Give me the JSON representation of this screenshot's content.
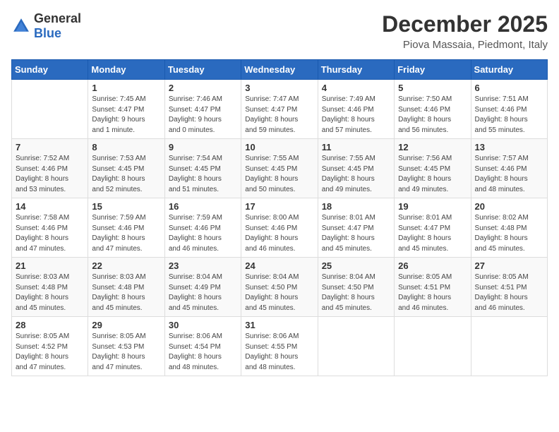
{
  "logo": {
    "general": "General",
    "blue": "Blue"
  },
  "header": {
    "month": "December 2025",
    "location": "Piova Massaia, Piedmont, Italy"
  },
  "days": [
    "Sunday",
    "Monday",
    "Tuesday",
    "Wednesday",
    "Thursday",
    "Friday",
    "Saturday"
  ],
  "weeks": [
    [
      {
        "day": "",
        "info": ""
      },
      {
        "day": "1",
        "info": "Sunrise: 7:45 AM\nSunset: 4:47 PM\nDaylight: 9 hours\nand 1 minute."
      },
      {
        "day": "2",
        "info": "Sunrise: 7:46 AM\nSunset: 4:47 PM\nDaylight: 9 hours\nand 0 minutes."
      },
      {
        "day": "3",
        "info": "Sunrise: 7:47 AM\nSunset: 4:47 PM\nDaylight: 8 hours\nand 59 minutes."
      },
      {
        "day": "4",
        "info": "Sunrise: 7:49 AM\nSunset: 4:46 PM\nDaylight: 8 hours\nand 57 minutes."
      },
      {
        "day": "5",
        "info": "Sunrise: 7:50 AM\nSunset: 4:46 PM\nDaylight: 8 hours\nand 56 minutes."
      },
      {
        "day": "6",
        "info": "Sunrise: 7:51 AM\nSunset: 4:46 PM\nDaylight: 8 hours\nand 55 minutes."
      }
    ],
    [
      {
        "day": "7",
        "info": "Sunrise: 7:52 AM\nSunset: 4:46 PM\nDaylight: 8 hours\nand 53 minutes."
      },
      {
        "day": "8",
        "info": "Sunrise: 7:53 AM\nSunset: 4:45 PM\nDaylight: 8 hours\nand 52 minutes."
      },
      {
        "day": "9",
        "info": "Sunrise: 7:54 AM\nSunset: 4:45 PM\nDaylight: 8 hours\nand 51 minutes."
      },
      {
        "day": "10",
        "info": "Sunrise: 7:55 AM\nSunset: 4:45 PM\nDaylight: 8 hours\nand 50 minutes."
      },
      {
        "day": "11",
        "info": "Sunrise: 7:55 AM\nSunset: 4:45 PM\nDaylight: 8 hours\nand 49 minutes."
      },
      {
        "day": "12",
        "info": "Sunrise: 7:56 AM\nSunset: 4:45 PM\nDaylight: 8 hours\nand 49 minutes."
      },
      {
        "day": "13",
        "info": "Sunrise: 7:57 AM\nSunset: 4:46 PM\nDaylight: 8 hours\nand 48 minutes."
      }
    ],
    [
      {
        "day": "14",
        "info": "Sunrise: 7:58 AM\nSunset: 4:46 PM\nDaylight: 8 hours\nand 47 minutes."
      },
      {
        "day": "15",
        "info": "Sunrise: 7:59 AM\nSunset: 4:46 PM\nDaylight: 8 hours\nand 47 minutes."
      },
      {
        "day": "16",
        "info": "Sunrise: 7:59 AM\nSunset: 4:46 PM\nDaylight: 8 hours\nand 46 minutes."
      },
      {
        "day": "17",
        "info": "Sunrise: 8:00 AM\nSunset: 4:46 PM\nDaylight: 8 hours\nand 46 minutes."
      },
      {
        "day": "18",
        "info": "Sunrise: 8:01 AM\nSunset: 4:47 PM\nDaylight: 8 hours\nand 45 minutes."
      },
      {
        "day": "19",
        "info": "Sunrise: 8:01 AM\nSunset: 4:47 PM\nDaylight: 8 hours\nand 45 minutes."
      },
      {
        "day": "20",
        "info": "Sunrise: 8:02 AM\nSunset: 4:48 PM\nDaylight: 8 hours\nand 45 minutes."
      }
    ],
    [
      {
        "day": "21",
        "info": "Sunrise: 8:03 AM\nSunset: 4:48 PM\nDaylight: 8 hours\nand 45 minutes."
      },
      {
        "day": "22",
        "info": "Sunrise: 8:03 AM\nSunset: 4:48 PM\nDaylight: 8 hours\nand 45 minutes."
      },
      {
        "day": "23",
        "info": "Sunrise: 8:04 AM\nSunset: 4:49 PM\nDaylight: 8 hours\nand 45 minutes."
      },
      {
        "day": "24",
        "info": "Sunrise: 8:04 AM\nSunset: 4:50 PM\nDaylight: 8 hours\nand 45 minutes."
      },
      {
        "day": "25",
        "info": "Sunrise: 8:04 AM\nSunset: 4:50 PM\nDaylight: 8 hours\nand 45 minutes."
      },
      {
        "day": "26",
        "info": "Sunrise: 8:05 AM\nSunset: 4:51 PM\nDaylight: 8 hours\nand 46 minutes."
      },
      {
        "day": "27",
        "info": "Sunrise: 8:05 AM\nSunset: 4:51 PM\nDaylight: 8 hours\nand 46 minutes."
      }
    ],
    [
      {
        "day": "28",
        "info": "Sunrise: 8:05 AM\nSunset: 4:52 PM\nDaylight: 8 hours\nand 47 minutes."
      },
      {
        "day": "29",
        "info": "Sunrise: 8:05 AM\nSunset: 4:53 PM\nDaylight: 8 hours\nand 47 minutes."
      },
      {
        "day": "30",
        "info": "Sunrise: 8:06 AM\nSunset: 4:54 PM\nDaylight: 8 hours\nand 48 minutes."
      },
      {
        "day": "31",
        "info": "Sunrise: 8:06 AM\nSunset: 4:55 PM\nDaylight: 8 hours\nand 48 minutes."
      },
      {
        "day": "",
        "info": ""
      },
      {
        "day": "",
        "info": ""
      },
      {
        "day": "",
        "info": ""
      }
    ]
  ]
}
